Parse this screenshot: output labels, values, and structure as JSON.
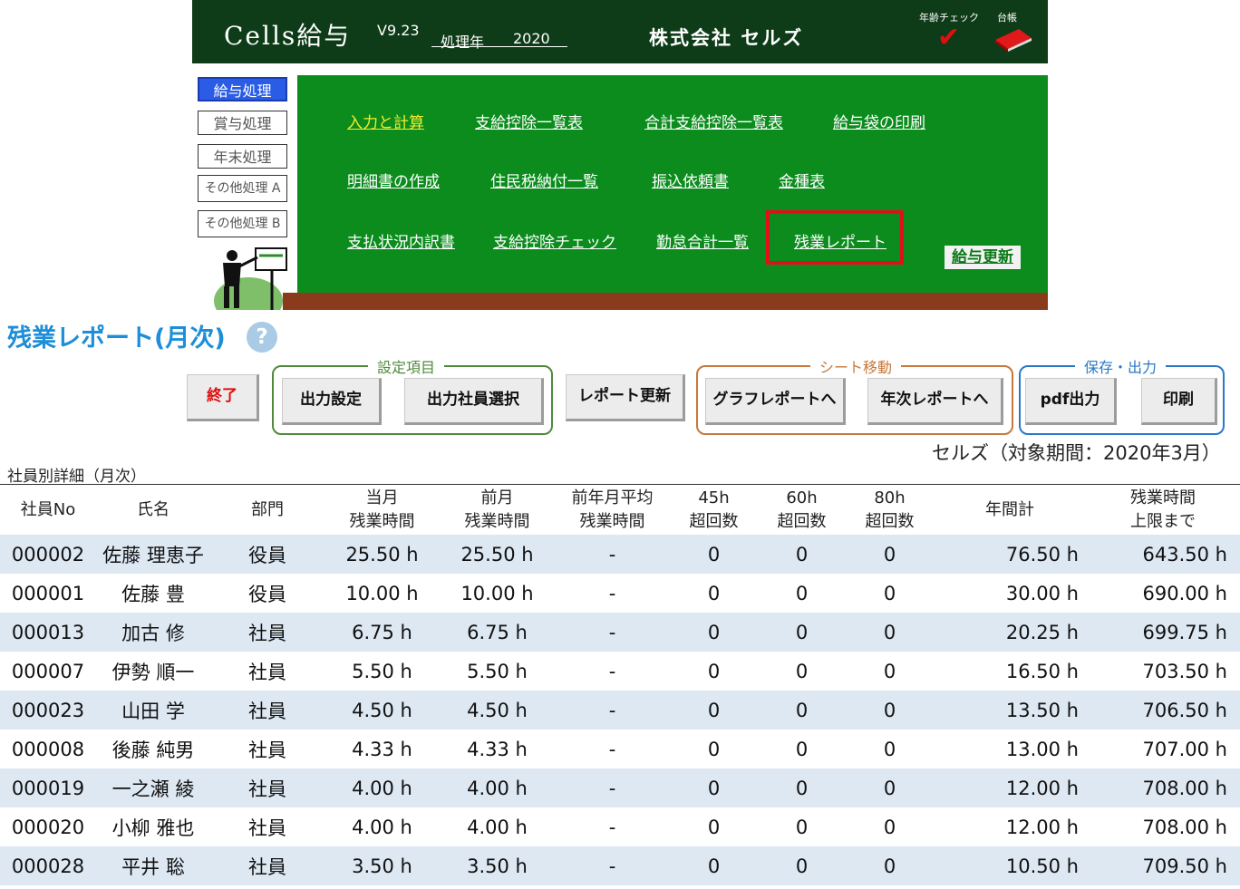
{
  "header": {
    "app_title": "Cells給与",
    "version": "V9.23",
    "year_label": "処理年",
    "year_value": "2020",
    "company": "株式会社 セルズ",
    "age_check_label": "年齢チェック",
    "ledger_label": "台帳"
  },
  "sidebar": {
    "items": [
      {
        "label": "給与処理"
      },
      {
        "label": "賞与処理"
      },
      {
        "label": "年末処理"
      },
      {
        "label": "その他処理 A"
      },
      {
        "label": "その他処理 B"
      }
    ]
  },
  "board": {
    "links": [
      "入力と計算",
      "支給控除一覧表",
      "合計支給控除一覧表",
      "給与袋の印刷",
      "明細書の作成",
      "住民税納付一覧",
      "振込依頼書",
      "金種表",
      "支払状況内訳書",
      "支給控除チェック",
      "勤怠合計一覧",
      "残業レポート"
    ],
    "update_button": "給与更新"
  },
  "page": {
    "title": "残業レポート(月次)",
    "help": "?"
  },
  "toolbar": {
    "exit": "終了",
    "settings_group": "設定項目",
    "output_settings": "出力設定",
    "select_employees": "出力社員選択",
    "refresh": "レポート更新",
    "sheet_group": "シート移動",
    "to_graph": "グラフレポートへ",
    "to_annual": "年次レポートへ",
    "save_group": "保存・出力",
    "pdf": "pdf出力",
    "print": "印刷"
  },
  "period": "セルズ（対象期間：2020年3月）",
  "section_label": "社員別詳細（月次）",
  "table": {
    "headers": [
      [
        "社員No"
      ],
      [
        "氏名"
      ],
      [
        "部門"
      ],
      [
        "当月",
        "残業時間"
      ],
      [
        "前月",
        "残業時間"
      ],
      [
        "前年月平均",
        "残業時間"
      ],
      [
        "45h",
        "超回数"
      ],
      [
        "60h",
        "超回数"
      ],
      [
        "80h",
        "超回数"
      ],
      [
        "年間計"
      ],
      [
        "残業時間",
        "上限まで"
      ]
    ],
    "rows": [
      [
        "000002",
        "佐藤 理恵子",
        "役員",
        "25.50 h",
        "25.50 h",
        "-",
        "0",
        "0",
        "0",
        "76.50 h",
        "643.50 h"
      ],
      [
        "000001",
        "佐藤 豊",
        "役員",
        "10.00 h",
        "10.00 h",
        "-",
        "0",
        "0",
        "0",
        "30.00 h",
        "690.00 h"
      ],
      [
        "000013",
        "加古 修",
        "社員",
        "6.75 h",
        "6.75 h",
        "-",
        "0",
        "0",
        "0",
        "20.25 h",
        "699.75 h"
      ],
      [
        "000007",
        "伊勢 順一",
        "社員",
        "5.50 h",
        "5.50 h",
        "-",
        "0",
        "0",
        "0",
        "16.50 h",
        "703.50 h"
      ],
      [
        "000023",
        "山田 学",
        "社員",
        "4.50 h",
        "4.50 h",
        "-",
        "0",
        "0",
        "0",
        "13.50 h",
        "706.50 h"
      ],
      [
        "000008",
        "後藤 純男",
        "社員",
        "4.33 h",
        "4.33 h",
        "-",
        "0",
        "0",
        "0",
        "13.00 h",
        "707.00 h"
      ],
      [
        "000019",
        "一之瀬 綾",
        "社員",
        "4.00 h",
        "4.00 h",
        "-",
        "0",
        "0",
        "0",
        "12.00 h",
        "708.00 h"
      ],
      [
        "000020",
        "小柳 雅也",
        "社員",
        "4.00 h",
        "4.00 h",
        "-",
        "0",
        "0",
        "0",
        "12.00 h",
        "708.00 h"
      ],
      [
        "000028",
        "平井 聡",
        "社員",
        "3.50 h",
        "3.50 h",
        "-",
        "0",
        "0",
        "0",
        "10.50 h",
        "709.50 h"
      ]
    ]
  }
}
